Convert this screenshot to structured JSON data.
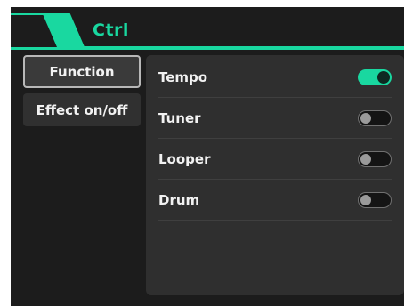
{
  "header": {
    "tab_label": "Ctrl",
    "accent_color": "#19d8a0"
  },
  "sidebar": {
    "items": [
      {
        "label": "Function",
        "active": true
      },
      {
        "label": "Effect on/off",
        "active": false
      }
    ]
  },
  "panel": {
    "rows": [
      {
        "label": "Tempo",
        "toggle_on": true
      },
      {
        "label": "Tuner",
        "toggle_on": false
      },
      {
        "label": "Looper",
        "toggle_on": false
      },
      {
        "label": "Drum",
        "toggle_on": false
      }
    ]
  }
}
